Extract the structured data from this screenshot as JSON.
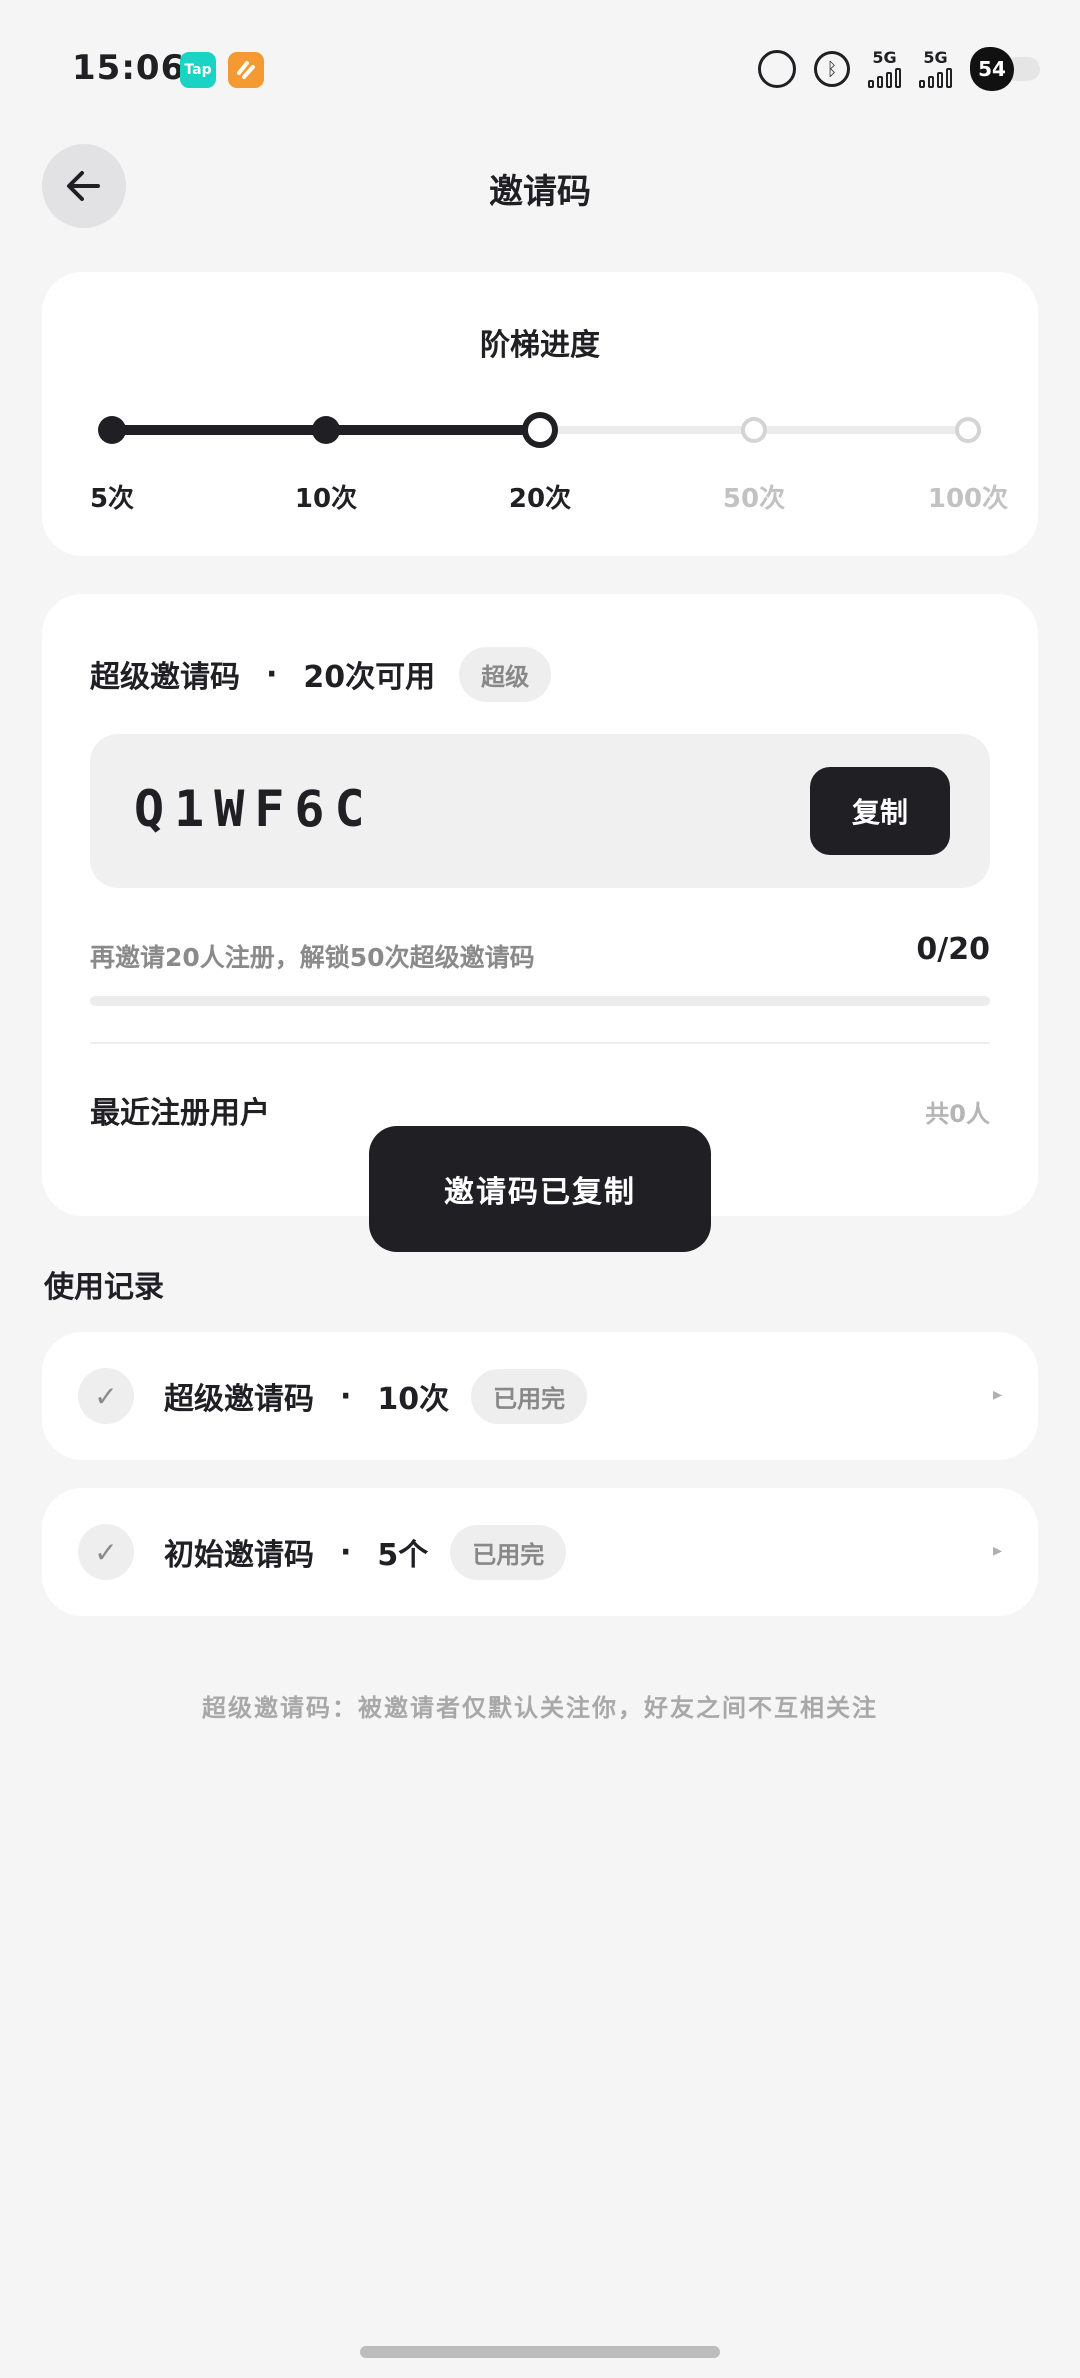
{
  "status_bar": {
    "time": "15:06",
    "apps": [
      {
        "name": "tap-icon",
        "label": "Tap"
      },
      {
        "name": "app-icon-2"
      }
    ],
    "signal1_label": "5G",
    "signal2_label": "5G",
    "battery": "54"
  },
  "header": {
    "title": "邀请码",
    "back_icon": "arrow-left-icon"
  },
  "ladder": {
    "title": "阶梯进度",
    "steps": [
      "5次",
      "10次",
      "20次",
      "50次",
      "100次"
    ],
    "current_index": 2
  },
  "invite": {
    "name": "超级邀请码",
    "sep": "·",
    "available": "20次可用",
    "tag": "超级",
    "code": "Q1WF6C",
    "copy_label": "复制",
    "progress_hint": "再邀请20人注册，解锁50次超级邀请码",
    "progress_count": "0/20",
    "progress_fraction": 0,
    "recent_label": "最近注册用户",
    "recent_count": "共0人"
  },
  "toast": {
    "message": "邀请码已复制"
  },
  "records": {
    "title": "使用记录",
    "items": [
      {
        "name": "超级邀请码",
        "sep": "·",
        "amount": "10次",
        "status": "已用完",
        "check": "✓",
        "arrow": "▸"
      },
      {
        "name": "初始邀请码",
        "sep": "·",
        "amount": "5个",
        "status": "已用完",
        "check": "✓",
        "arrow": "▸"
      }
    ]
  },
  "footer_note": "超级邀请码：被邀请者仅默认关注你，好友之间不互相关注"
}
